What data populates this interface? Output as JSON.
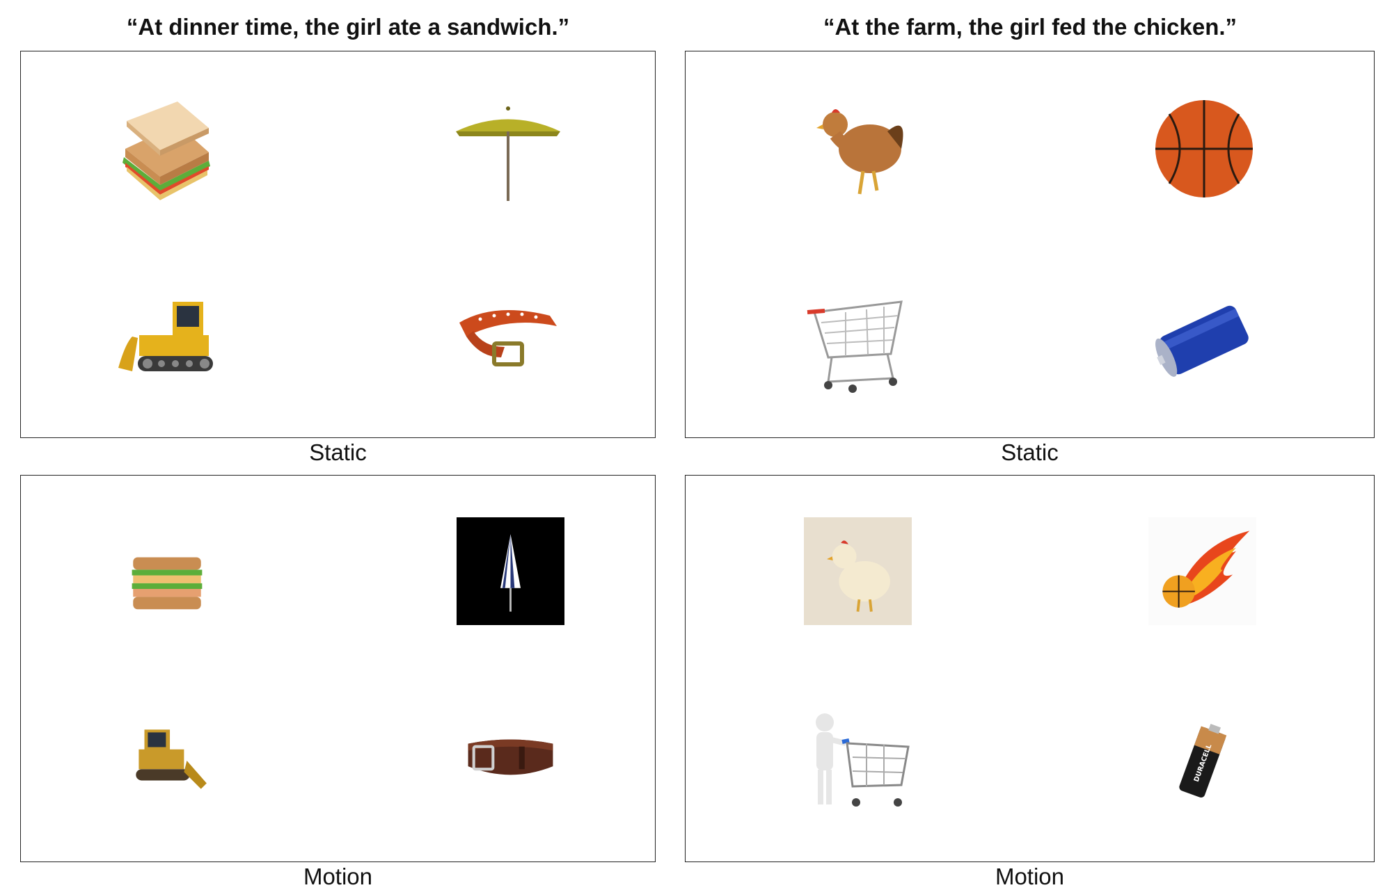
{
  "columns": [
    {
      "title": "“At dinner time, the girl ate a sandwich.”",
      "conditions": [
        "Static",
        "Motion"
      ],
      "static_items": [
        "sandwich-icon",
        "umbrella-icon",
        "bulldozer-icon",
        "belt-icon"
      ],
      "motion_items": [
        "stacked-sandwich-icon",
        "closed-umbrella-icon",
        "bulldozer-icon",
        "leather-belt-icon"
      ]
    },
    {
      "title": "“At the farm, the girl fed the chicken.”",
      "conditions": [
        "Static",
        "Motion"
      ],
      "static_items": [
        "chicken-icon",
        "basketball-icon",
        "shopping-cart-icon",
        "battery-icon"
      ],
      "motion_items": [
        "cartoon-chicken-icon",
        "flaming-basketball-icon",
        "person-pushing-cart-icon",
        "aa-battery-icon"
      ]
    }
  ],
  "battery_brand": "DURACELL",
  "colors": {
    "border": "#222222",
    "text": "#111111",
    "background": "#ffffff"
  }
}
